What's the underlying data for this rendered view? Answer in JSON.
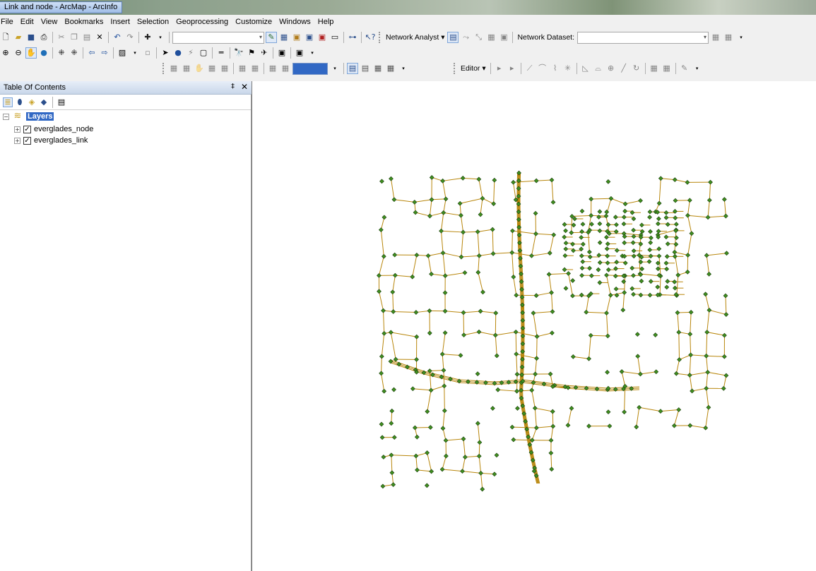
{
  "window": {
    "title": "Link and node - ArcMap - ArcInfo"
  },
  "menu": [
    "File",
    "Edit",
    "View",
    "Bookmarks",
    "Insert",
    "Selection",
    "Geoprocessing",
    "Customize",
    "Windows",
    "Help"
  ],
  "toolbar": {
    "network_analyst_label": "Network Analyst ▾",
    "network_dataset_label": "Network Dataset:",
    "network_dataset_value": "",
    "editor_label": "Editor ▾",
    "scale_value": ""
  },
  "toc": {
    "title": "Table Of Contents",
    "pin_glyph": "‡",
    "close_glyph": "✕",
    "root_label": "Layers",
    "layers": [
      {
        "name": "everglades_node",
        "checked": true
      },
      {
        "name": "everglades_link",
        "checked": true
      }
    ]
  },
  "map": {
    "node_fill": "#3f8f1f",
    "node_stroke": "#1a3d0c",
    "link_color": "#b8860b"
  }
}
